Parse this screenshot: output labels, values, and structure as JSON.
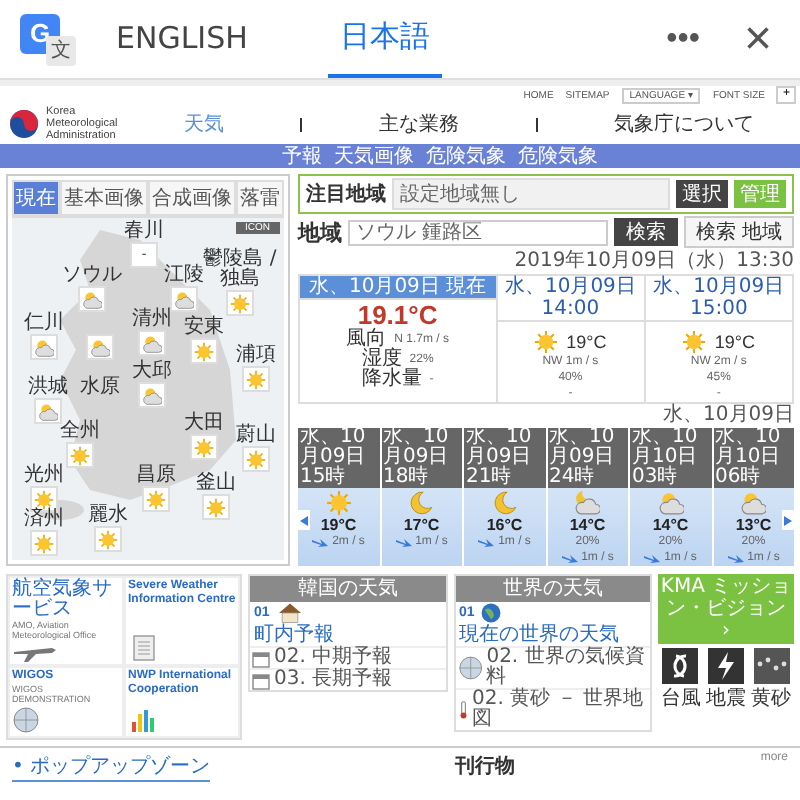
{
  "translate_bar": {
    "logo_letters": [
      "G",
      "文"
    ],
    "tabs": [
      {
        "label": "ENGLISH",
        "selected": false
      },
      {
        "label": "日本語",
        "selected": true
      }
    ],
    "more": "•••",
    "close": "×"
  },
  "utility": {
    "links": [
      "HOME",
      "SITEMAP"
    ],
    "language": "LANGUAGE",
    "language_caret": "▾",
    "font_size": "FONT SIZE",
    "font_plus": "+"
  },
  "header": {
    "org": "Korea Meteorological Administration",
    "nav": [
      {
        "label": "天気",
        "selected": true
      },
      {
        "label": "主な業務",
        "selected": false
      },
      {
        "label": "気象庁について",
        "selected": false
      }
    ],
    "subnav": [
      "予報",
      "天気画像",
      "危険気象",
      "危険気象"
    ]
  },
  "map_panel": {
    "tabs": [
      {
        "label": "現在",
        "selected": true
      },
      {
        "label": "基本画像",
        "selected": false
      },
      {
        "label": "合成画像",
        "selected": false
      },
      {
        "label": "落雷",
        "selected": false
      }
    ],
    "badge": "ICON",
    "pins": [
      {
        "label": "春川",
        "kind": "none",
        "text": "-"
      },
      {
        "label": "ソウル",
        "kind": "partly"
      },
      {
        "label": "江陵",
        "kind": "partly"
      },
      {
        "label": "鬱陵島 / 独島",
        "kind": "sun"
      },
      {
        "label": "仁川",
        "kind": "partly"
      },
      {
        "kind": "partly"
      },
      {
        "label": "清州",
        "kind": "partly"
      },
      {
        "label": "水原",
        "kind": "label"
      },
      {
        "label": "安東",
        "kind": "sun"
      },
      {
        "label": "洪城",
        "kind": "partly"
      },
      {
        "label": "大邱",
        "kind": "partly"
      },
      {
        "label": "大田",
        "kind": "sun"
      },
      {
        "label": "浦項",
        "kind": "sun"
      },
      {
        "label": "全州",
        "kind": "sun"
      },
      {
        "label": "蔚山",
        "kind": "sun"
      },
      {
        "label": "光州",
        "kind": "sun"
      },
      {
        "label": "昌原",
        "kind": "sun"
      },
      {
        "label": "釜山",
        "kind": "sun"
      },
      {
        "label": "麗水",
        "kind": "sun"
      },
      {
        "label": "済州",
        "kind": "sun"
      }
    ]
  },
  "attention": {
    "label": "注目地域",
    "select": "設定地域無し",
    "buttons": [
      "選択",
      "管理"
    ]
  },
  "region": {
    "label": "地域",
    "value": "ソウル 鍾路区",
    "search": "検索",
    "search_area": "検索 地域"
  },
  "datetime": "2019年10月09日（水）13:30",
  "current": {
    "header": "水、10月09日 現在",
    "temp": "19.1°C",
    "rows": [
      {
        "label": "風向",
        "value": "N 1.7m / s"
      },
      {
        "label": "湿度",
        "value": "22%"
      },
      {
        "label": "降水量",
        "value": "-"
      }
    ]
  },
  "next": [
    {
      "header": "水、10月09日 14:00",
      "temp": "19°C",
      "wind": "NW 1m / s",
      "humidity": "40%",
      "rain": "-"
    },
    {
      "header": "水、10月09日 15:00",
      "temp": "19°C",
      "wind": "NW 2m / s",
      "humidity": "45%",
      "rain": "-"
    }
  ],
  "hourly_date": "水、10月09日",
  "hourly": [
    {
      "time": "水、10月09日15時",
      "kind": "sun",
      "temp": "19°C",
      "wind": "2m / s"
    },
    {
      "time": "水、10月09日18時",
      "kind": "moon",
      "temp": "17°C",
      "wind": "1m / s"
    },
    {
      "time": "水、10月09日21時",
      "kind": "moon",
      "temp": "16°C",
      "wind": "1m / s"
    },
    {
      "time": "水、10月09日24時",
      "kind": "moon-cloud",
      "temp": "14°C",
      "pop": "20%",
      "wind": "1m / s"
    },
    {
      "time": "水、10月10日03時",
      "kind": "partly",
      "temp": "14°C",
      "pop": "20%",
      "wind": "1m / s"
    },
    {
      "time": "水、10月10日06時",
      "kind": "partly",
      "temp": "13°C",
      "pop": "20%",
      "wind": "1m / s"
    }
  ],
  "services": [
    {
      "title": "航空気象サービス",
      "desc": "AMO, Aviation Meteorological Office",
      "kind": "plane"
    },
    {
      "title": "Severe Weather Information Centre",
      "kind": "document"
    },
    {
      "title": "WIGOS",
      "desc": "WIGOS DEMONSTRATION",
      "kind": "globe"
    },
    {
      "title": "NWP International Cooperation",
      "kind": "chart"
    }
  ],
  "korea_weather": {
    "title": "韓国の天気",
    "number": "01",
    "main": "町内予報",
    "items": [
      {
        "label": "02. 中期予報",
        "kind": "calendar"
      },
      {
        "label": "03. 長期予報",
        "kind": "calendar"
      }
    ]
  },
  "world_weather": {
    "title": "世界の天気",
    "number": "01",
    "main": "現在の世界の天気",
    "items": [
      {
        "label": "02. 世界の気候資料",
        "kind": "globe"
      },
      {
        "label": "02. 黄砂 － 世界地図",
        "kind": "thermometer"
      }
    ]
  },
  "mission": {
    "title": "KMA ミッション・ビジョン",
    "arrow": "›",
    "items": [
      {
        "label": "台風",
        "kind": "typhoon"
      },
      {
        "label": "地震",
        "kind": "quake"
      },
      {
        "label": "黄砂",
        "kind": "dust"
      }
    ]
  },
  "footer": {
    "popup": "• ポップアップゾーン",
    "publications": "刊行物",
    "more": "more"
  }
}
